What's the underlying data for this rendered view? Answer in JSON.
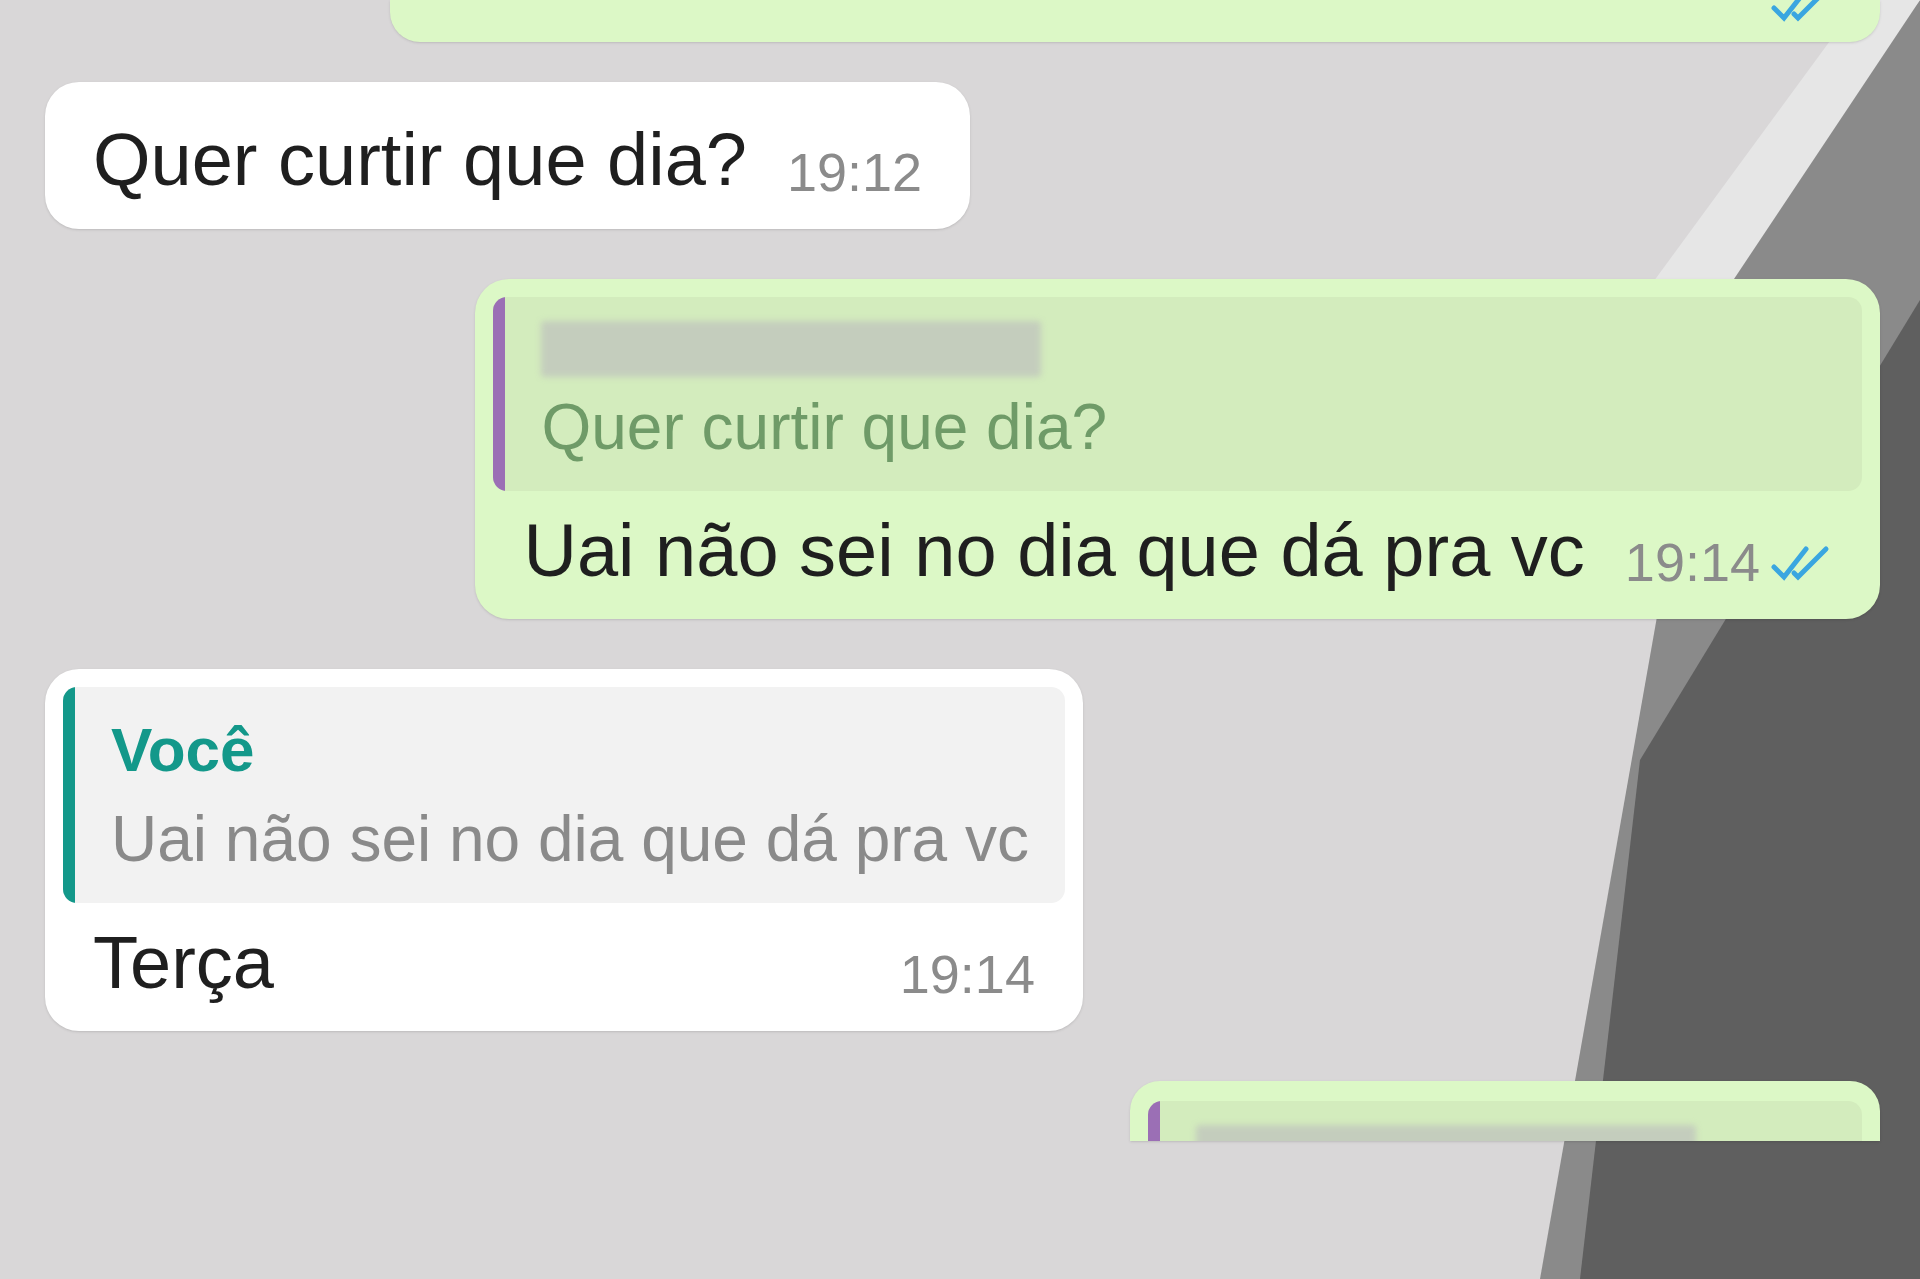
{
  "messages": [
    {
      "kind": "sent",
      "read": true
    },
    {
      "kind": "received",
      "text": "Quer curtir que dia?",
      "time": "19:12"
    },
    {
      "kind": "sent",
      "quote": {
        "author_hidden": true,
        "text": "Quer curtir que dia?",
        "color": "#9b6fb5"
      },
      "text": "Uai não sei no dia que dá pra vc",
      "time": "19:14",
      "read": true
    },
    {
      "kind": "received",
      "quote": {
        "author": "Você",
        "text": "Uai não sei no dia que dá pra vc",
        "color": "#13988a"
      },
      "text": "Terça",
      "time": "19:14"
    },
    {
      "kind": "sent",
      "quote": {
        "author_hidden": true,
        "color": "#9b6fb5"
      }
    }
  ]
}
